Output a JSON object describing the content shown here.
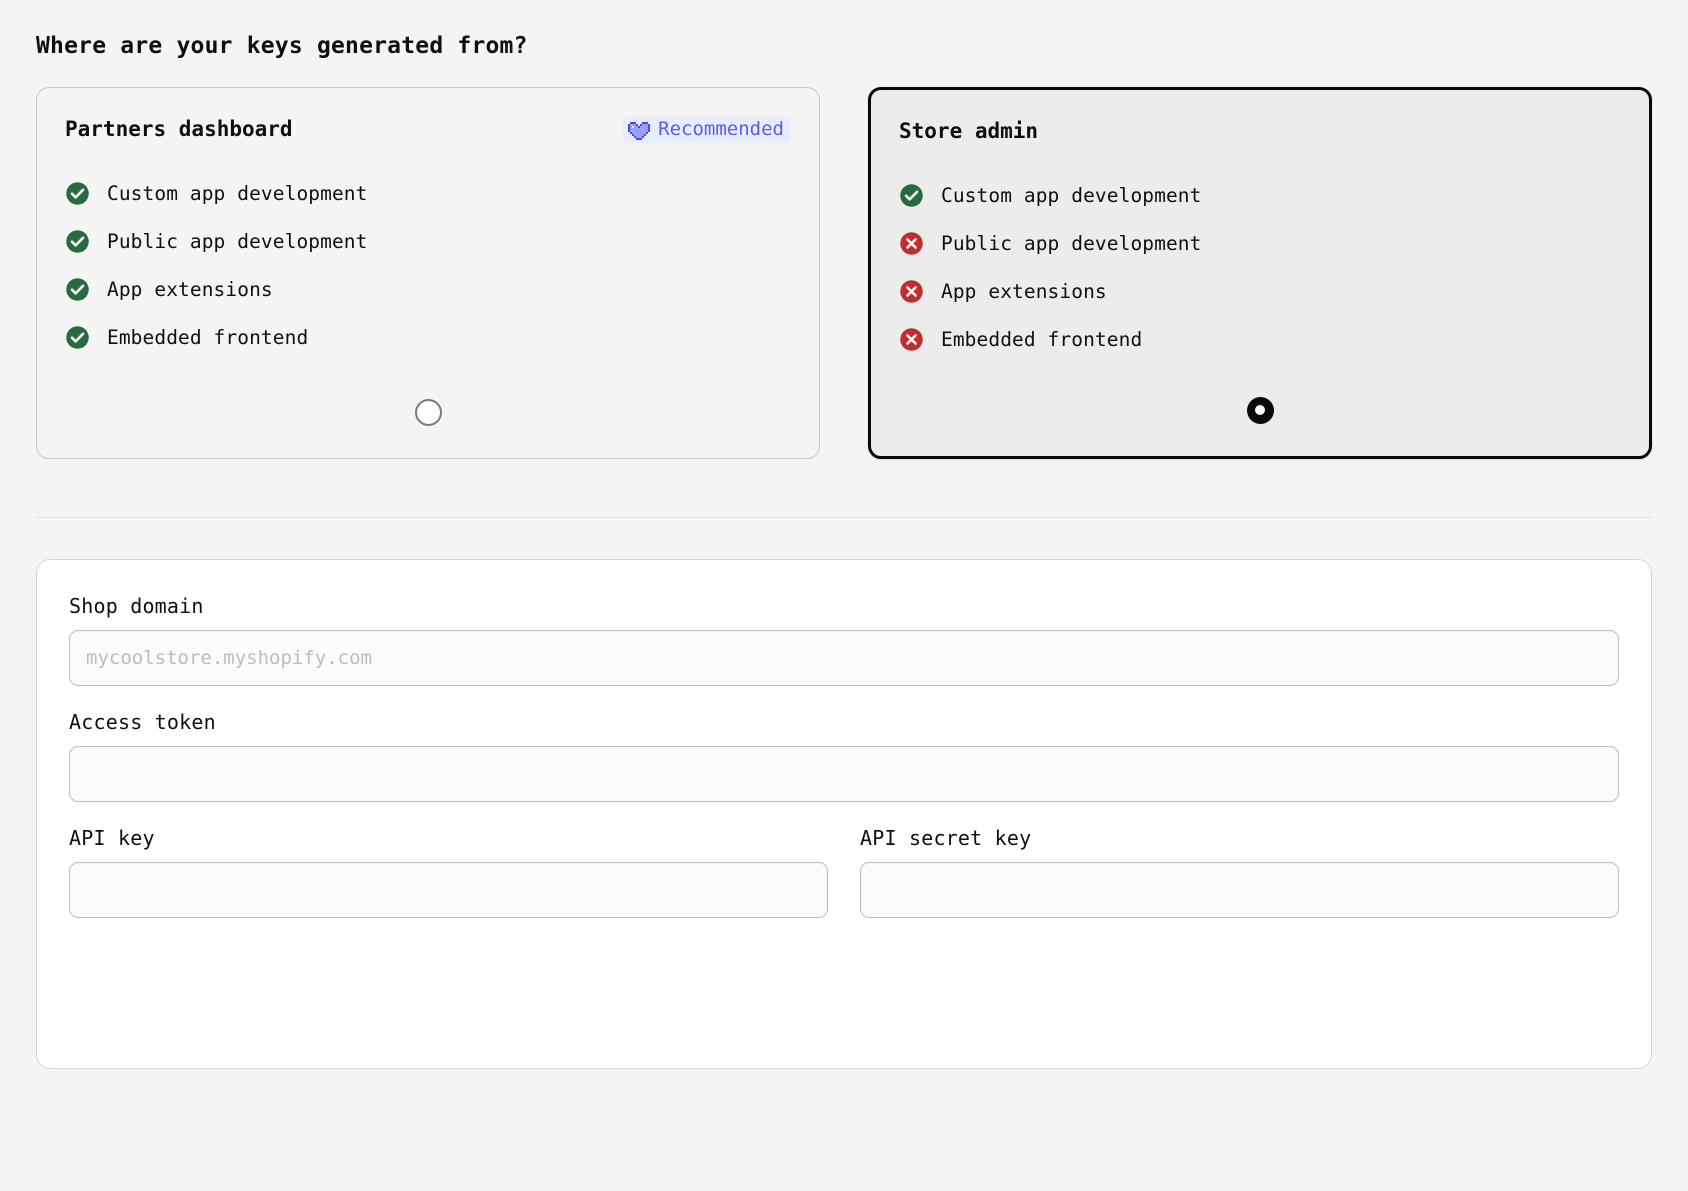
{
  "page": {
    "title": "Where are your keys generated from?"
  },
  "options": [
    {
      "id": "partners-dashboard",
      "title": "Partners dashboard",
      "selected": false,
      "badge": {
        "label": "Recommended",
        "icon": "purple-heart-icon",
        "text_color": "#5b5bf0",
        "background_color": "#e8edfe"
      },
      "features": [
        {
          "label": "Custom app development",
          "status": "supported"
        },
        {
          "label": "Public app development",
          "status": "supported"
        },
        {
          "label": "App extensions",
          "status": "supported"
        },
        {
          "label": "Embedded frontend",
          "status": "supported"
        }
      ]
    },
    {
      "id": "store-admin",
      "title": "Store admin",
      "selected": true,
      "badge": null,
      "features": [
        {
          "label": "Custom app development",
          "status": "supported"
        },
        {
          "label": "Public app development",
          "status": "unsupported"
        },
        {
          "label": "App extensions",
          "status": "unsupported"
        },
        {
          "label": "Embedded frontend",
          "status": "unsupported"
        }
      ]
    }
  ],
  "form": {
    "shop_domain": {
      "label": "Shop domain",
      "placeholder": "mycoolstore.myshopify.com",
      "value": ""
    },
    "access_token": {
      "label": "Access token",
      "placeholder": "",
      "value": ""
    },
    "api_key": {
      "label": "API key",
      "placeholder": "",
      "value": ""
    },
    "api_secret_key": {
      "label": "API secret key",
      "placeholder": "",
      "value": ""
    }
  },
  "colors": {
    "page_background": "#f4f4f4",
    "selected_card_background": "#ececec",
    "selected_card_border": "#0a0a0a",
    "unselected_card_border": "#c9c9c9",
    "success_green": "#256a40",
    "error_red": "#bc2f2a",
    "accent_purple": "#5b5bf0",
    "form_card_background": "#ffffff"
  }
}
